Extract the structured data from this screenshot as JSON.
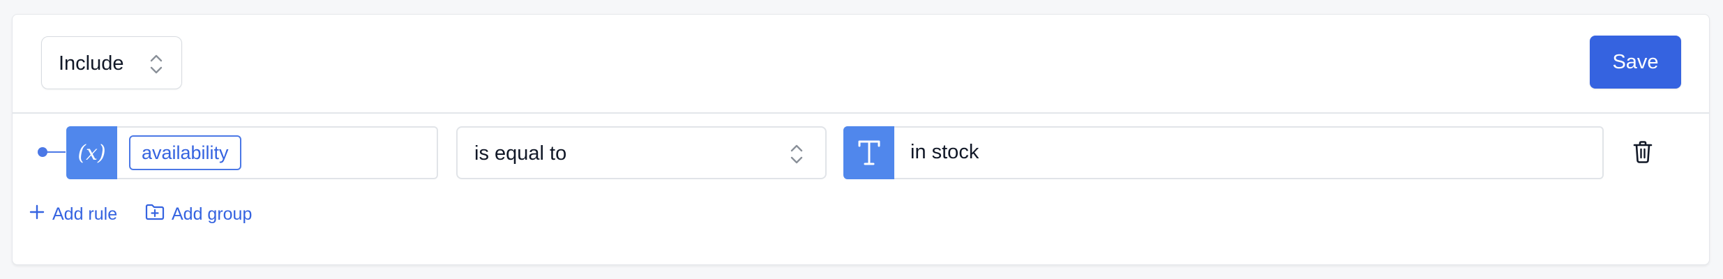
{
  "header": {
    "mode_select": {
      "value": "Include"
    },
    "save_label": "Save"
  },
  "rule": {
    "field": {
      "label": "availability",
      "icon": "variable-icon",
      "icon_text": "(x)"
    },
    "operator": {
      "value": "is equal to"
    },
    "value": {
      "text": "in stock",
      "icon": "text-type-icon"
    },
    "delete_icon": "trash-icon"
  },
  "actions": {
    "add_rule_label": "Add rule",
    "add_group_label": "Add group"
  },
  "colors": {
    "accent": "#3563e0",
    "icon_bg": "#5087ec",
    "border": "#e1e4e8",
    "background": "#f6f7f9"
  }
}
